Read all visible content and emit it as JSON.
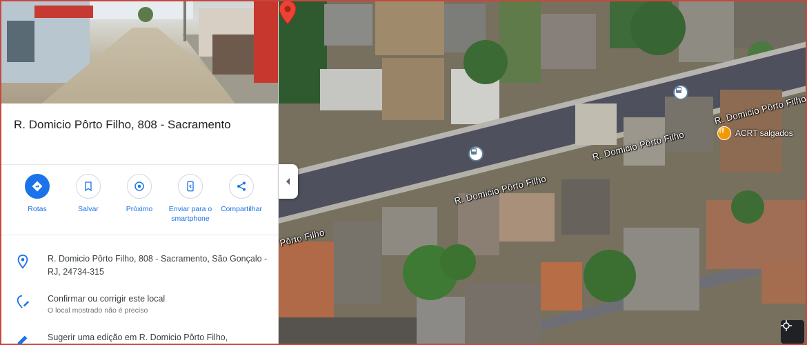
{
  "place": {
    "title": "R. Domicio Pôrto Filho, 808 - Sacramento"
  },
  "actions": [
    {
      "label": "Rotas",
      "icon": "directions-icon"
    },
    {
      "label": "Salvar",
      "icon": "save-icon"
    },
    {
      "label": "Próximo",
      "icon": "nearby-icon"
    },
    {
      "label": "Enviar para o smartphone",
      "icon": "send-to-phone-icon"
    },
    {
      "label": "Compartilhar",
      "icon": "share-icon"
    }
  ],
  "info": {
    "address": "R. Domicio Pôrto Filho, 808 - Sacramento, São Gonçalo - RJ, 24734-315",
    "confirm_title": "Confirmar ou corrigir este local",
    "confirm_sub": "O local mostrado não é preciso",
    "suggest": "Sugerir uma edição em R. Domicio Pôrto Filho,"
  },
  "map": {
    "road_labels": [
      "R. Domicio Pôrto Filho",
      "R. Domicio Pôrto Filho",
      "R. Domicio Pôrto Filho",
      "Pôrto Filho"
    ],
    "poi_label": "ACRT salgados",
    "colors": {
      "accent": "#1a73e8",
      "pin": "#ea4335",
      "poi": "#f29900"
    }
  }
}
